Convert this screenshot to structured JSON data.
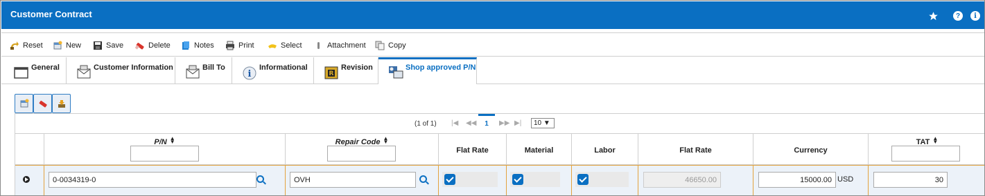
{
  "header": {
    "title": "Customer Contract"
  },
  "toolbar": {
    "items": [
      {
        "label": "Reset",
        "icon": "reset-icon"
      },
      {
        "label": "New",
        "icon": "new-icon"
      },
      {
        "label": "Save",
        "icon": "save-icon"
      },
      {
        "label": "Delete",
        "icon": "delete-icon"
      },
      {
        "label": "Notes",
        "icon": "notes-icon"
      },
      {
        "label": "Print",
        "icon": "print-icon"
      },
      {
        "label": "Select",
        "icon": "select-icon"
      },
      {
        "label": "Attachment",
        "icon": "attachment-icon"
      },
      {
        "label": "Copy",
        "icon": "copy-icon"
      }
    ]
  },
  "tabs": [
    {
      "label": "General"
    },
    {
      "label": "Customer Information"
    },
    {
      "label": "Bill To"
    },
    {
      "label": "Informational"
    },
    {
      "label": "Revision"
    },
    {
      "label": "Shop approved P/N",
      "active": true
    }
  ],
  "pager": {
    "summary": "(1 of 1)",
    "current_page": "1",
    "page_size": "10 ▼"
  },
  "columns": {
    "pn": "P/N",
    "repair_code": "Repair Code",
    "flat_rate_chk": "Flat Rate",
    "material": "Material",
    "labor": "Labor",
    "flat_rate": "Flat Rate",
    "currency": "Currency",
    "tat": "TAT"
  },
  "row": {
    "pn": "0-0034319-0",
    "repair_code": "OVH",
    "flat_rate_checked": true,
    "material_checked": true,
    "labor_checked": true,
    "flat_rate_value": "46650.00",
    "currency_value": "15000.00",
    "currency_code": "USD",
    "tat": "30"
  },
  "colors": {
    "accent": "#0a6fc2",
    "row_highlight": "#e3a23d"
  }
}
